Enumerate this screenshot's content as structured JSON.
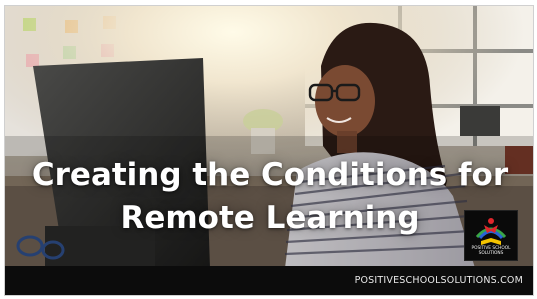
{
  "headline": {
    "line1": "Creating the Conditions for",
    "line2": "Remote Learning"
  },
  "footer": {
    "url": "POSITIVESCHOOLSOLUTIONS.COM"
  },
  "logo": {
    "line1": "POSITIVE SCHOOL",
    "line2": "SOLUTIONS"
  },
  "colors": {
    "footer_bg": "#0c0c0c",
    "headline_text": "#ffffff",
    "logo_red": "#e0262c",
    "logo_yellow": "#f5c400",
    "logo_blue": "#2a63d6",
    "logo_green": "#3aa648"
  }
}
